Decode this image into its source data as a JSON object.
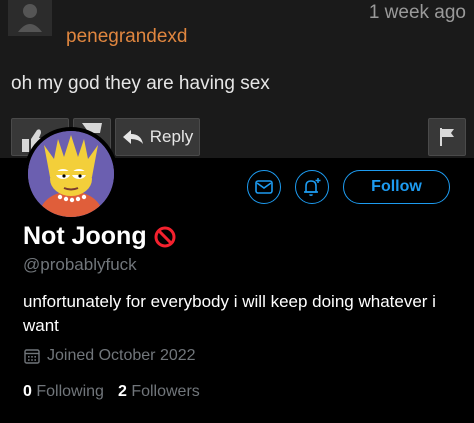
{
  "comment": {
    "username": "penegrandexd",
    "timestamp": "1 week ago",
    "text": "oh my god they are having sex",
    "reply_label": "Reply",
    "icons": [
      "thumbs-up-icon",
      "thumbs-down-icon",
      "reply-arrow-icon",
      "flag-icon"
    ]
  },
  "profile": {
    "display_name": "Not Joong",
    "handle": "@probablyfuck",
    "bio": "unfortunately for everybody i will keep doing whatever i want",
    "joined": "Joined October 2022",
    "following_count": "0",
    "following_label": "Following",
    "followers_count": "2",
    "followers_label": "Followers",
    "follow_label": "Follow",
    "icons": [
      "mail-icon",
      "notification-bell-icon",
      "prohibited-icon",
      "calendar-icon"
    ]
  },
  "colors": {
    "accent": "#1d9bf0",
    "username_orange": "#e0863f",
    "muted": "#71767b",
    "prohibited_red": "#f4212e"
  }
}
